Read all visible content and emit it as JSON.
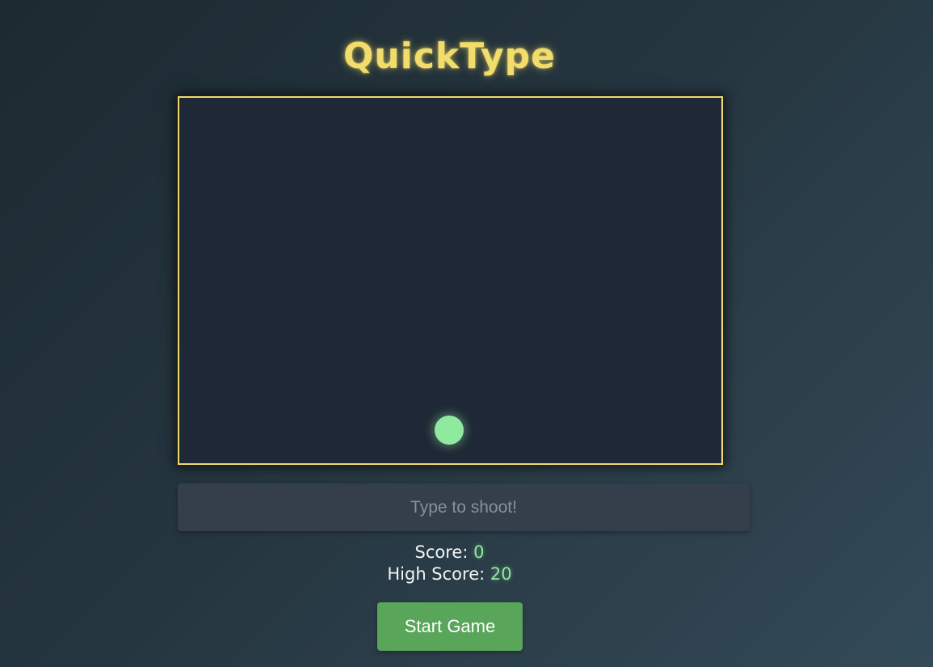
{
  "app": {
    "title": "QuickType"
  },
  "game": {
    "player_color": "#8fea9f",
    "border_color": "#f0d96a"
  },
  "input": {
    "placeholder": "Type to shoot!",
    "value": ""
  },
  "stats": {
    "score_label": "Score:",
    "score_value": "0",
    "high_score_label": "High Score:",
    "high_score_value": "20"
  },
  "controls": {
    "start_label": "Start Game"
  },
  "colors": {
    "title": "#f2dc6a",
    "accent": "#8fea9f",
    "button": "#59a65a"
  }
}
